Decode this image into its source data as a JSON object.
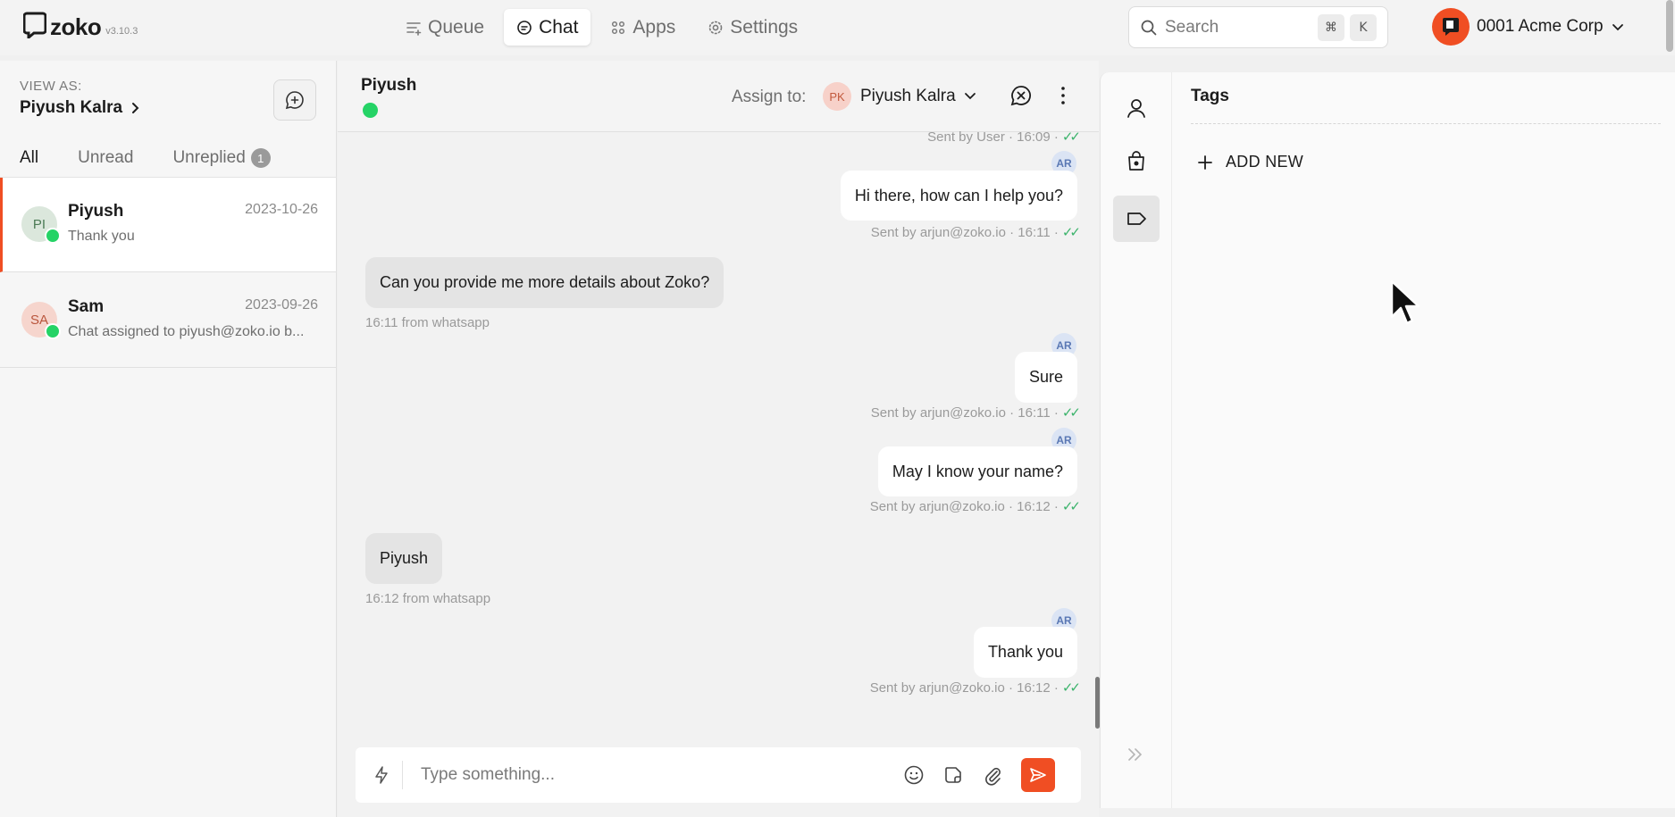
{
  "brand": {
    "name": "zoko",
    "version": "v3.10.3"
  },
  "nav": [
    {
      "label": "Queue",
      "icon": "queue-icon"
    },
    {
      "label": "Chat",
      "icon": "chat-icon"
    },
    {
      "label": "Apps",
      "icon": "apps-icon"
    },
    {
      "label": "Settings",
      "icon": "gear-icon"
    }
  ],
  "search": {
    "placeholder": "Search",
    "shortcut": [
      "⌘",
      "K"
    ]
  },
  "account": {
    "name": "0001 Acme Corp"
  },
  "sidebar": {
    "view_as_label": "VIEW AS:",
    "view_as_name": "Piyush Kalra",
    "tabs": [
      {
        "label": "All"
      },
      {
        "label": "Unread"
      },
      {
        "label": "Unreplied",
        "badge": "1"
      }
    ],
    "conversations": [
      {
        "initials": "PI",
        "name": "Piyush",
        "date": "2023-10-26",
        "preview": "Thank you",
        "avatar_bg": "#dbe7dc",
        "avatar_fg": "#4b7a55"
      },
      {
        "initials": "SA",
        "name": "Sam",
        "date": "2023-09-26",
        "preview": "Chat assigned to piyush@zoko.io b...",
        "avatar_bg": "#f6d5cd",
        "avatar_fg": "#b9553c"
      }
    ]
  },
  "chat": {
    "contact_name": "Piyush",
    "assign_label": "Assign to:",
    "assignee_initials": "PK",
    "assignee_name": "Piyush Kalra",
    "messages": [
      {
        "dir": "meta-only",
        "meta": "Sent by User · 16:09 ·"
      },
      {
        "dir": "out",
        "agent": "AR",
        "text": "Hi there, how can I help you?",
        "meta": "Sent by arjun@zoko.io · 16:11 ·"
      },
      {
        "dir": "in",
        "text": "Can you provide me more details about Zoko?",
        "meta": "16:11 from whatsapp"
      },
      {
        "dir": "out",
        "agent": "AR",
        "text": "Sure",
        "meta": "Sent by arjun@zoko.io · 16:11 ·"
      },
      {
        "dir": "out",
        "agent": "AR",
        "text": "May I know your name?",
        "meta": "Sent by arjun@zoko.io · 16:12 ·"
      },
      {
        "dir": "in",
        "text": "Piyush",
        "meta": "16:12 from whatsapp"
      },
      {
        "dir": "out",
        "agent": "AR",
        "text": "Thank you",
        "meta": "Sent by arjun@zoko.io · 16:12 ·"
      }
    ],
    "composer_placeholder": "Type something..."
  },
  "right_panel": {
    "tags_title": "Tags",
    "add_new_label": "ADD NEW"
  },
  "colors": {
    "accent": "#f04e23",
    "whatsapp": "#25d366",
    "read_tick": "#3bb36b"
  }
}
